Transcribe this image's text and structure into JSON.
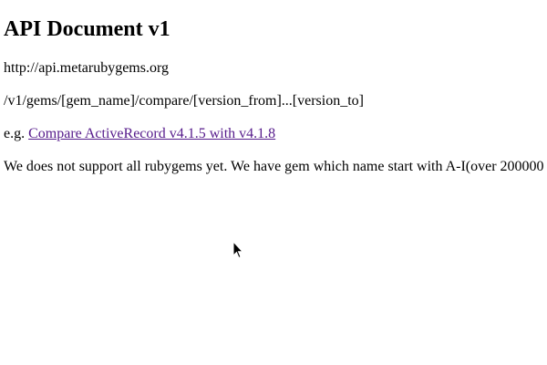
{
  "page": {
    "title": "API Document v1",
    "host": "http://api.metarubygems.org",
    "endpoint": "/v1/gems/[gem_name]/compare/[version_from]...[version_to]",
    "example_prefix": "e.g.",
    "example_link_text": "Compare ActiveRecord v4.1.5 with v4.1.8",
    "support_note": "We does not support all rubygems yet. We have gem which name start with A-I(over 200000"
  },
  "colors": {
    "text": "#000000",
    "visited_link": "#551a8b",
    "background": "#ffffff"
  },
  "icons": {
    "cursor": "mouse-pointer-icon"
  }
}
